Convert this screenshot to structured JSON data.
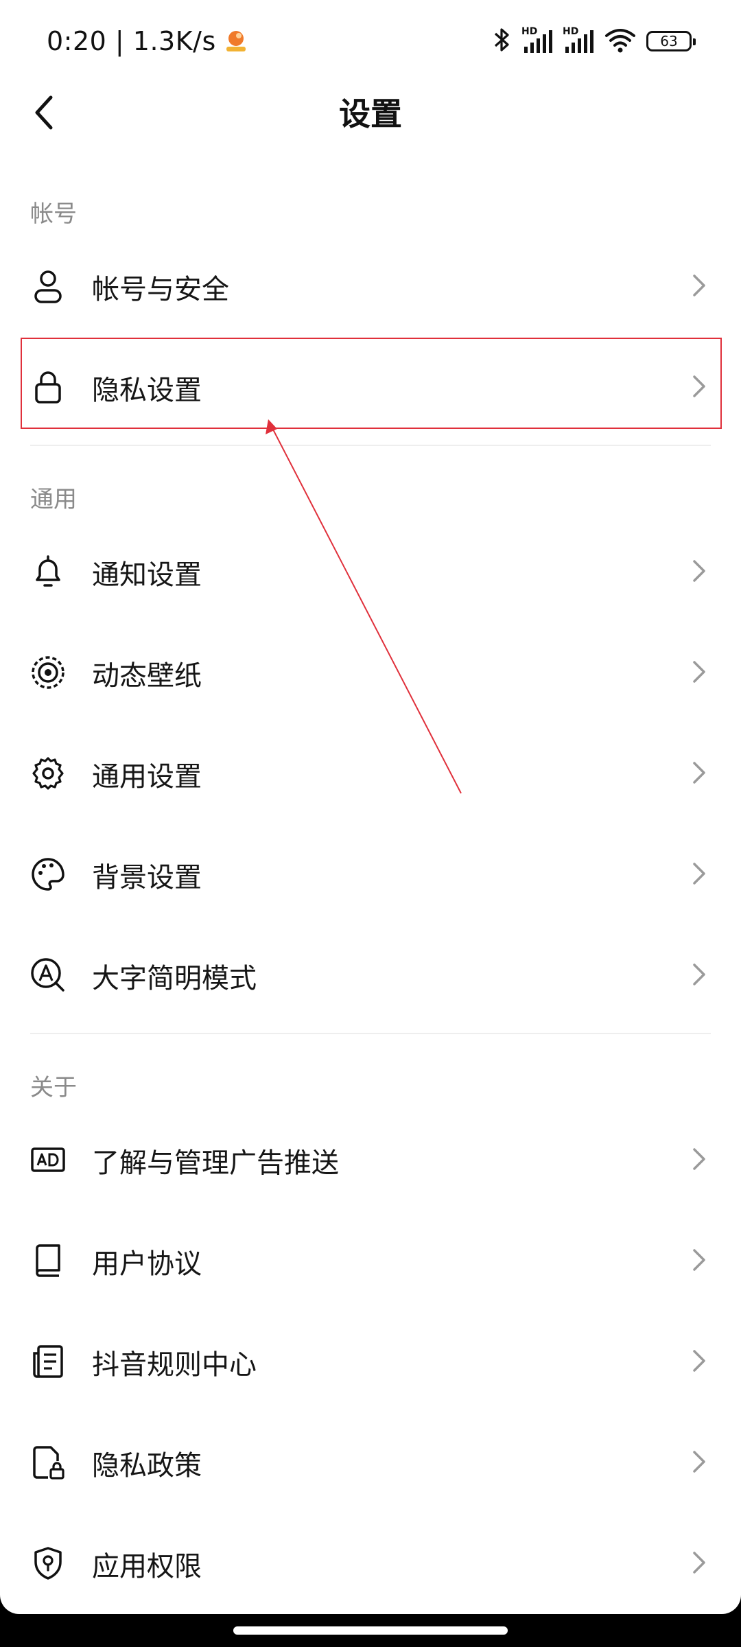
{
  "status_bar": {
    "time_speed": "0:20 | 1.3K/s",
    "hd1": "HD",
    "hd2": "HD",
    "battery": "63"
  },
  "header": {
    "title": "设置"
  },
  "sections": {
    "account": {
      "title": "帐号",
      "items": [
        {
          "label": "帐号与安全",
          "icon": "person-icon"
        },
        {
          "label": "隐私设置",
          "icon": "lock-icon"
        }
      ]
    },
    "general": {
      "title": "通用",
      "items": [
        {
          "label": "通知设置",
          "icon": "bell-icon"
        },
        {
          "label": "动态壁纸",
          "icon": "live-wallpaper-icon"
        },
        {
          "label": "通用设置",
          "icon": "gear-icon"
        },
        {
          "label": "背景设置",
          "icon": "palette-icon"
        },
        {
          "label": "大字简明模式",
          "icon": "large-text-icon"
        }
      ]
    },
    "about": {
      "title": "关于",
      "items": [
        {
          "label": "了解与管理广告推送",
          "icon": "ad-icon"
        },
        {
          "label": "用户协议",
          "icon": "book-icon"
        },
        {
          "label": "抖音规则中心",
          "icon": "document-list-icon"
        },
        {
          "label": "隐私政策",
          "icon": "file-lock-icon"
        },
        {
          "label": "应用权限",
          "icon": "shield-icon"
        }
      ]
    }
  },
  "colors": {
    "highlight": "#e0303b",
    "text": "#161616",
    "section_title": "#8a8a8a"
  }
}
